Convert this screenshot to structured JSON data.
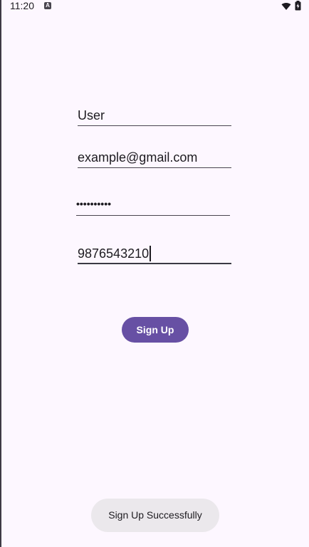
{
  "status_bar": {
    "time": "11:20",
    "notification_icon": "android-a-icon",
    "wifi_icon": "wifi-icon",
    "battery_icon": "battery-charging-icon"
  },
  "form": {
    "username": {
      "value": "User"
    },
    "email": {
      "value": "example@gmail.com"
    },
    "password": {
      "value": "••••••••••"
    },
    "phone": {
      "value": "9876543210"
    }
  },
  "signup_button": {
    "label": "Sign Up"
  },
  "toast": {
    "message": "Sign Up Successfully"
  },
  "colors": {
    "background": "#fdf7ff",
    "accent": "#6750a4",
    "toast_bg": "#ebe8ec"
  }
}
